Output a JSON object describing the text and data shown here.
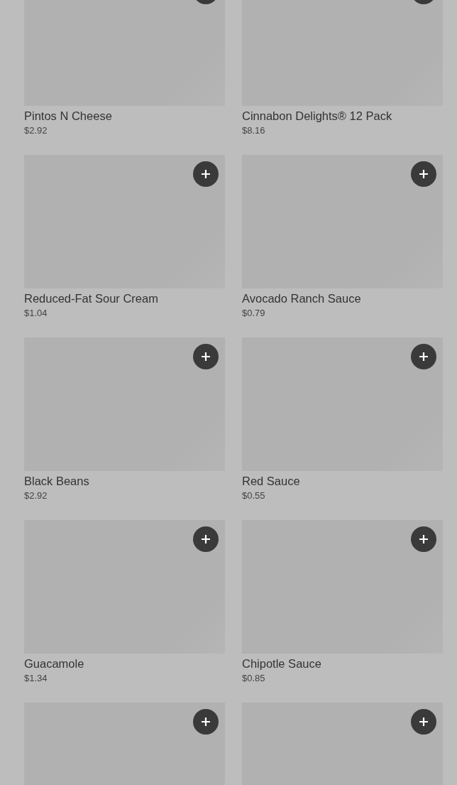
{
  "items": [
    {
      "kind": "top_cut",
      "name": "Pintos N Cheese",
      "price": "$2.92"
    },
    {
      "kind": "top_cut",
      "name": "Cinnabon Delights® 12 Pack",
      "price": "$8.16"
    },
    {
      "kind": "full",
      "name": "Reduced-Fat Sour Cream",
      "price": "$1.04"
    },
    {
      "kind": "full",
      "name": "Avocado Ranch Sauce",
      "price": "$0.79"
    },
    {
      "kind": "full",
      "name": "Black Beans",
      "price": "$2.92"
    },
    {
      "kind": "full",
      "name": "Red Sauce",
      "price": "$0.55"
    },
    {
      "kind": "full",
      "name": "Guacamole",
      "price": "$1.34"
    },
    {
      "kind": "full",
      "name": "Chipotle Sauce",
      "price": "$0.85"
    },
    {
      "kind": "image_only"
    },
    {
      "kind": "image_only"
    }
  ]
}
